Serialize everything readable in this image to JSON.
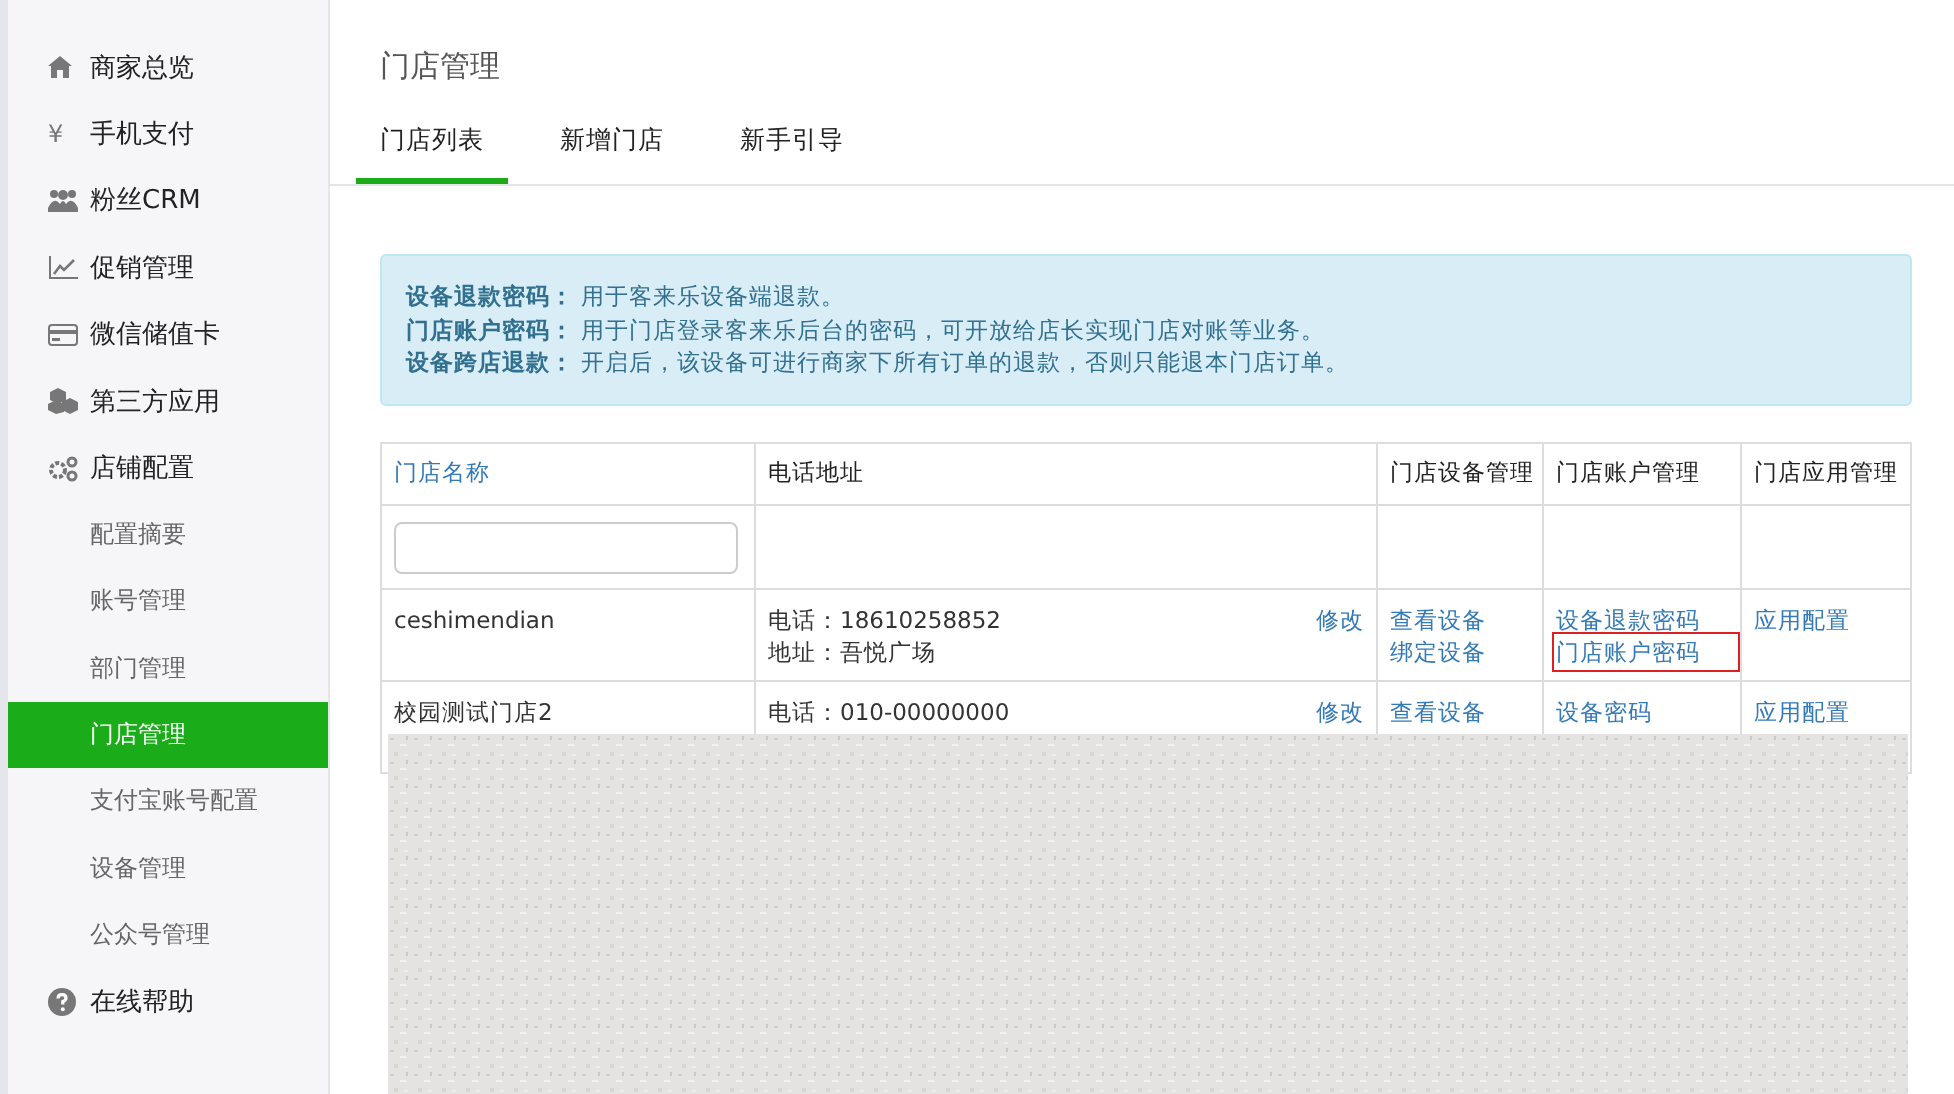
{
  "sidebar": {
    "items": [
      {
        "kind": "main",
        "label": "商家总览",
        "selected": false
      },
      {
        "kind": "main",
        "glyph": "¥",
        "label": "手机支付",
        "selected": false
      },
      {
        "kind": "main",
        "label": "粉丝CRM",
        "selected": false
      },
      {
        "kind": "main",
        "label": "促销管理",
        "selected": false
      },
      {
        "kind": "main",
        "label": "微信储值卡",
        "selected": false
      },
      {
        "kind": "main",
        "label": "第三方应用",
        "selected": false
      },
      {
        "kind": "main",
        "label": "店铺配置",
        "selected": false
      },
      {
        "kind": "sub",
        "label": "配置摘要",
        "selected": false
      },
      {
        "kind": "sub",
        "label": "账号管理",
        "selected": false
      },
      {
        "kind": "sub",
        "label": "部门管理",
        "selected": false
      },
      {
        "kind": "sub",
        "label": "门店管理",
        "selected": true
      },
      {
        "kind": "sub",
        "label": "支付宝账号配置",
        "selected": false
      },
      {
        "kind": "sub",
        "label": "设备管理",
        "selected": false
      },
      {
        "kind": "sub",
        "label": "公众号管理",
        "selected": false
      },
      {
        "kind": "main",
        "label": "在线帮助",
        "selected": false
      }
    ]
  },
  "page_title": "门店管理",
  "tabs": [
    {
      "label": "门店列表",
      "selected": true
    },
    {
      "label": "新增门店",
      "selected": false
    },
    {
      "label": "新手引导",
      "selected": false
    }
  ],
  "notice": [
    {
      "term": "设备退款密码：",
      "text": "用于客来乐设备端退款。"
    },
    {
      "term": "门店账户密码：",
      "text": "用于门店登录客来乐后台的密码，可开放给店长实现门店对账等业务。"
    },
    {
      "term": "设备跨店退款：",
      "text": "开启后，该设备可进行商家下所有订单的退款，否则只能退本门店订单。"
    }
  ],
  "table": {
    "columns": [
      {
        "label": "门店名称",
        "link": true
      },
      {
        "label": "电话地址",
        "link": false
      },
      {
        "label": "门店设备管理",
        "link": false
      },
      {
        "label": "门店账户管理",
        "link": false
      },
      {
        "label": "门店应用管理",
        "link": false
      }
    ],
    "rows": [
      {
        "name": "ceshimendian",
        "contact": [
          "电话：18610258852",
          "地址：吾悦广场"
        ],
        "edit": "修改",
        "device_links": [
          {
            "label": "查看设备",
            "highlighted": false
          },
          {
            "label": "绑定设备",
            "highlighted": false
          }
        ],
        "account_links": [
          {
            "label": "设备退款密码",
            "highlighted": false
          },
          {
            "label": "门店账户密码",
            "highlighted": true
          }
        ],
        "app_links": [
          {
            "label": "应用配置",
            "highlighted": false
          }
        ]
      },
      {
        "name": "校园测试门店2",
        "contact": [
          "电话：010-00000000"
        ],
        "edit": "修改",
        "device_links": [
          {
            "label": "查看设备",
            "highlighted": false
          }
        ],
        "account_links": [
          {
            "label": "设备密码",
            "highlighted": false
          }
        ],
        "app_links": [
          {
            "label": "应用配置",
            "highlighted": false
          }
        ]
      }
    ]
  }
}
